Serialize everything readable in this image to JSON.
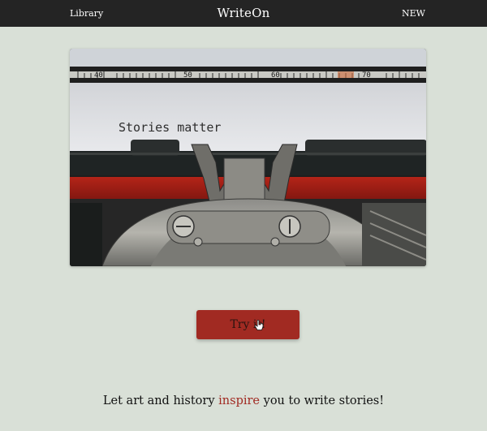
{
  "nav": {
    "library_label": "Library",
    "brand": "WriteOn",
    "new_label": "NEW"
  },
  "hero": {
    "paper_text": "Stories matter",
    "ruler_numbers": [
      "40",
      "50",
      "60",
      "70"
    ]
  },
  "cta": {
    "label": "Try it!"
  },
  "tagline": {
    "before": "Let art and history ",
    "highlight": "inspire",
    "after": " you to write stories!"
  },
  "colors": {
    "background": "#d9e0d7",
    "topbar": "#242424",
    "accent": "#a12a22"
  },
  "icons": {
    "cursor": "hand-pointer-icon"
  }
}
